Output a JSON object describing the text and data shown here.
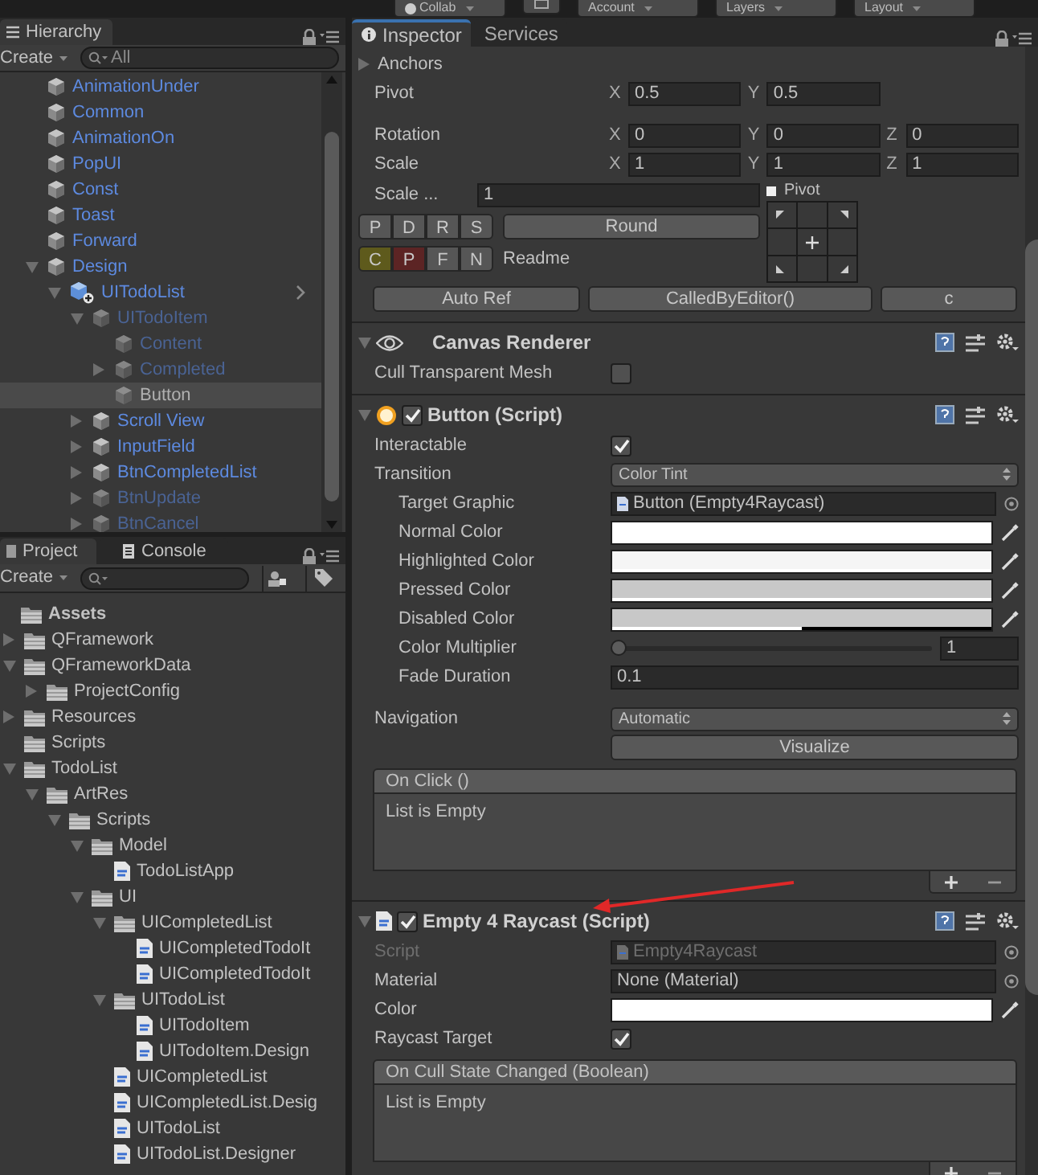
{
  "toolbar": {
    "buttons": [
      {
        "label": "Collab",
        "kind": "collab"
      },
      {
        "kind": "icon"
      },
      {
        "label": "Account",
        "kind": "menu"
      },
      {
        "label": "Layers",
        "kind": "menu"
      },
      {
        "label": "Layout",
        "kind": "menu"
      }
    ]
  },
  "hierarchy": {
    "tab": "Hierarchy",
    "create": "Create",
    "search": {
      "placeholder": "All"
    },
    "items": [
      {
        "label": "AnimationUnder",
        "kind": "prefab",
        "selected": false
      },
      {
        "label": "Common",
        "kind": "prefab",
        "selected": false
      },
      {
        "label": "AnimationOn",
        "kind": "prefab",
        "selected": false
      },
      {
        "label": "PopUI",
        "kind": "prefab",
        "selected": false
      },
      {
        "label": "Const",
        "kind": "prefab",
        "selected": false
      },
      {
        "label": "Toast",
        "kind": "prefab",
        "selected": false
      },
      {
        "label": "Forward",
        "kind": "prefab",
        "selected": false
      },
      {
        "label": "Design",
        "kind": "prefab",
        "selected": false,
        "expanded": true,
        "children": [
          {
            "label": "UITodoList",
            "kind": "prefab_root",
            "selected": false,
            "expanded": true,
            "children": [
              {
                "label": "UITodoItem",
                "kind": "prefab_inactive",
                "selected": false,
                "expanded": true,
                "children": [
                  {
                    "label": "Content",
                    "kind": "prefab_inactive",
                    "selected": false
                  },
                  {
                    "label": "Completed",
                    "kind": "prefab_inactive",
                    "selected": false,
                    "expanded": false
                  },
                  {
                    "label": "Button",
                    "kind": "prefab_inactive",
                    "selected": true
                  }
                ]
              },
              {
                "label": "Scroll View",
                "kind": "prefab",
                "selected": false,
                "expanded": false
              },
              {
                "label": "InputField",
                "kind": "prefab",
                "selected": false,
                "expanded": false
              },
              {
                "label": "BtnCompletedList",
                "kind": "prefab",
                "selected": false,
                "expanded": false
              },
              {
                "label": "BtnUpdate",
                "kind": "prefab_inactive",
                "selected": false,
                "expanded": false
              },
              {
                "label": "BtnCancel",
                "kind": "prefab_inactive",
                "selected": false,
                "expanded": false
              }
            ]
          }
        ]
      }
    ]
  },
  "project": {
    "tabs": [
      {
        "label": "Project",
        "selected": true
      },
      {
        "label": "Console",
        "selected": false
      }
    ],
    "create": "Create",
    "items": [
      {
        "label": "Assets",
        "kind": "folder",
        "children": [
          {
            "label": "QFramework",
            "kind": "folder",
            "expanded": false
          },
          {
            "label": "QFrameworkData",
            "kind": "folder",
            "expanded": true,
            "children": [
              {
                "label": "ProjectConfig",
                "kind": "folder",
                "expanded": false
              }
            ]
          },
          {
            "label": "Resources",
            "kind": "folder",
            "expanded": false
          },
          {
            "label": "Scripts",
            "kind": "folder"
          },
          {
            "label": "TodoList",
            "kind": "folder",
            "expanded": true,
            "children": [
              {
                "label": "ArtRes",
                "kind": "folder",
                "expanded": true,
                "children": [
                  {
                    "label": "Scripts",
                    "kind": "folder",
                    "expanded": true,
                    "children": [
                      {
                        "label": "Model",
                        "kind": "folder",
                        "expanded": true,
                        "children": [
                          {
                            "label": "TodoListApp",
                            "kind": "script"
                          }
                        ]
                      },
                      {
                        "label": "UI",
                        "kind": "folder",
                        "expanded": true,
                        "children": [
                          {
                            "label": "UICompletedList",
                            "kind": "folder",
                            "expanded": true,
                            "children": [
                              {
                                "label": "UICompletedTodoIt",
                                "kind": "script"
                              },
                              {
                                "label": "UICompletedTodoIt",
                                "kind": "script"
                              }
                            ]
                          },
                          {
                            "label": "UITodoList",
                            "kind": "folder",
                            "expanded": true,
                            "children": [
                              {
                                "label": "UITodoItem",
                                "kind": "script"
                              },
                              {
                                "label": "UITodoItem.Design",
                                "kind": "script"
                              }
                            ]
                          },
                          {
                            "label": "UICompletedList",
                            "kind": "script"
                          },
                          {
                            "label": "UICompletedList.Desig",
                            "kind": "script"
                          },
                          {
                            "label": "UITodoList",
                            "kind": "script"
                          },
                          {
                            "label": "UITodoList.Designer",
                            "kind": "script"
                          }
                        ]
                      }
                    ]
                  }
                ]
              }
            ]
          }
        ]
      }
    ]
  },
  "inspector": {
    "tabs": [
      {
        "label": "Inspector",
        "selected": true
      },
      {
        "label": "Services",
        "selected": false
      }
    ],
    "rect_transform": {
      "anchors": {
        "label": "Anchors",
        "expanded": false
      },
      "rows": [
        {
          "label": "Pivot",
          "axes": [
            {
              "axis": "X",
              "value": "0.5"
            },
            {
              "axis": "Y",
              "value": "0.5"
            }
          ]
        },
        {
          "label": "Rotation",
          "axes": [
            {
              "axis": "X",
              "value": "0"
            },
            {
              "axis": "Y",
              "value": "0"
            },
            {
              "axis": "Z",
              "value": "0"
            }
          ]
        },
        {
          "label": "Scale",
          "axes": [
            {
              "axis": "X",
              "value": "1"
            },
            {
              "axis": "Y",
              "value": "1"
            },
            {
              "axis": "Z",
              "value": "1"
            }
          ]
        }
      ],
      "scale_field": {
        "label": "Scale ...",
        "value": "1"
      },
      "pivot_label": "Pivot",
      "pdrs": [
        {
          "label": "P",
          "color": "#565656"
        },
        {
          "label": "D",
          "color": "#565656"
        },
        {
          "label": "R",
          "color": "#565656"
        },
        {
          "label": "S",
          "color": "#565656"
        }
      ],
      "round": "Round",
      "cpfn": [
        {
          "label": "C",
          "color": "#5e5a1c"
        },
        {
          "label": "P",
          "color": "#5c2424"
        },
        {
          "label": "F",
          "color": "#565656"
        },
        {
          "label": "N",
          "color": "#565656"
        }
      ],
      "readme": "Readme",
      "actions": [
        "Auto Ref",
        "CalledByEditor()",
        "c"
      ]
    },
    "components": [
      {
        "title": "Canvas Renderer",
        "kind": "renderer",
        "expanded": true,
        "groups": [
          [
            {
              "kind": "checkbox",
              "label": "Cull Transparent Mesh",
              "checked": false
            }
          ]
        ]
      },
      {
        "title": "Button (Script)",
        "kind": "button",
        "enabled": true,
        "expanded": true,
        "groups": [
          [
            {
              "kind": "checkbox",
              "label": "Interactable",
              "checked": true
            },
            {
              "kind": "dropdown",
              "label": "Transition",
              "value": "Color Tint",
              "children": [
                {
                  "kind": "script_ref",
                  "label": "Target Graphic",
                  "value": "Button (Empty4Raycast)",
                  "disabled": false
                },
                {
                  "kind": "color",
                  "label": "Normal Color",
                  "color": "#ffffff",
                  "level": 1
                },
                {
                  "kind": "color",
                  "label": "Highlighted Color",
                  "color": "#f5f5f5",
                  "level": 1
                },
                {
                  "kind": "color",
                  "label": "Pressed Color",
                  "color": "#c8c8c8",
                  "level": 1
                },
                {
                  "kind": "color",
                  "label": "Disabled Color",
                  "color": "#c8c8c8",
                  "level": 0.5
                },
                {
                  "kind": "slider",
                  "label": "Color Multiplier",
                  "level": 0,
                  "value": "1"
                },
                {
                  "kind": "number",
                  "label": "Fade Duration",
                  "value": "0.1"
                }
              ]
            }
          ],
          [
            {
              "kind": "dropdown",
              "label": "Navigation",
              "value": "Automatic"
            },
            {
              "kind": "button",
              "value": "Visualize"
            }
          ]
        ],
        "event": {
          "title": "On Click ()",
          "body": "List is Empty"
        }
      },
      {
        "title": "Empty 4 Raycast (Script)",
        "kind": "script",
        "enabled": true,
        "expanded": true,
        "groups": [
          [
            {
              "kind": "script_ref",
              "label": "Script",
              "value": "Empty4Raycast",
              "disabled": true
            },
            {
              "kind": "object",
              "label": "Material",
              "value": "None (Material)",
              "disabled": false
            },
            {
              "kind": "color",
              "label": "Color",
              "color": "#ffffff",
              "level": 1
            },
            {
              "kind": "checkbox",
              "label": "Raycast Target",
              "checked": true
            }
          ]
        ],
        "event": {
          "title": "On Cull State Changed (Boolean)",
          "body": "List is Empty"
        }
      }
    ]
  }
}
